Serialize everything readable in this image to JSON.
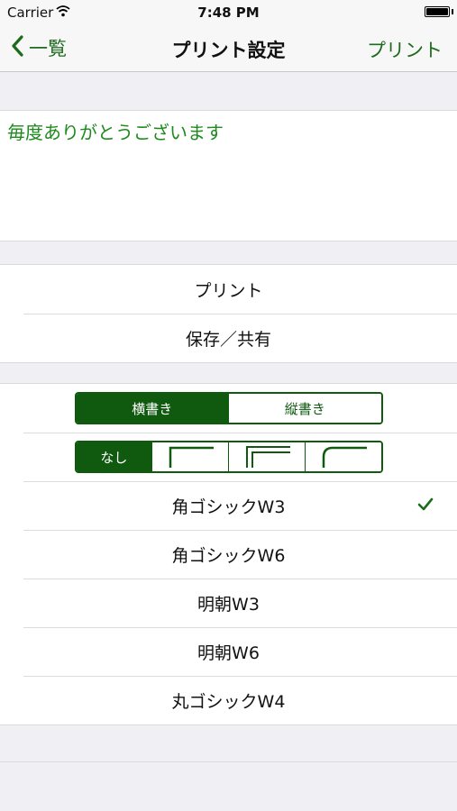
{
  "status_bar": {
    "carrier": "Carrier",
    "time": "7:48 PM"
  },
  "nav": {
    "back_label": "一覧",
    "title": "プリント設定",
    "right_label": "プリント"
  },
  "message": {
    "text": "毎度ありがとうございます"
  },
  "actions": [
    "プリント",
    "保存／共有"
  ],
  "orientation": {
    "options": [
      "横書き",
      "縦書き"
    ],
    "selected_index": 0
  },
  "border_style": {
    "options": [
      "なし",
      "single-corner-frame",
      "double-corner-frame",
      "rounded-corner-frame"
    ],
    "selected_index": 0
  },
  "fonts": {
    "items": [
      "角ゴシックW3",
      "角ゴシックW6",
      "明朝W3",
      "明朝W6",
      "丸ゴシックW4"
    ],
    "selected_index": 0
  },
  "colors": {
    "accent": "#1e6b1e",
    "segment": "#0f5a0f",
    "message_text": "#1e8a1e"
  }
}
